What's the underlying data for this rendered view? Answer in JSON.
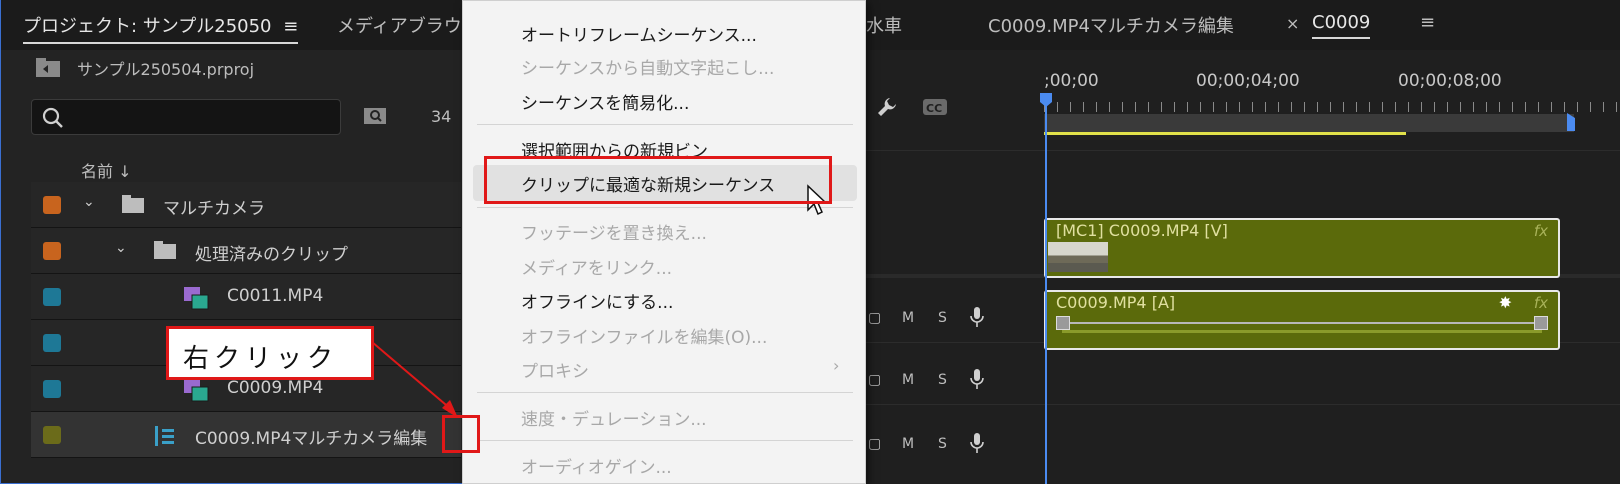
{
  "project_panel": {
    "tab_project": "プロジェクト: サンプル25050",
    "tab_project_menu": "≡",
    "tab_media_browser": "メディアブラウ",
    "project_file": "サンプル250504.prproj",
    "search_value": "",
    "item_count": "34",
    "column_name": "名前 ↓",
    "rows": [
      {
        "label": "マルチカメラ",
        "swatch": "#c8641e",
        "chevron": "⌄",
        "icon": "folder-icon"
      },
      {
        "label": "処理済みのクリップ",
        "swatch": "#c8641e",
        "chevron": "⌄",
        "icon": "folder-icon"
      },
      {
        "label": "C0011.MP4",
        "swatch": "#1e7896",
        "icon": "video-clip-icon"
      },
      {
        "label": "",
        "swatch": "#1e7896",
        "icon": ""
      },
      {
        "label": "C0009.MP4",
        "swatch": "#1e7896",
        "icon": "video-clip-icon"
      },
      {
        "label": "C0009.MP4マルチカメラ編集",
        "swatch": "#6b6b1a",
        "icon": "multicam-sequence-icon"
      }
    ]
  },
  "timeline_panel": {
    "tabs": [
      {
        "label": "水車"
      },
      {
        "label": "C0009.MP4マルチカメラ編集"
      }
    ],
    "tab_close": "×",
    "active_tab": "C0009",
    "active_tab_menu": "≡",
    "timecodes": [
      ";00;00",
      "00;00;04;00",
      "00;00;08;00"
    ],
    "video_clip_label": "[MC1] C0009.MP4 [V]",
    "audio_clip_label": "C0009.MP4 [A]",
    "fx_label": "fx",
    "track_mute": "M",
    "track_solo": "S"
  },
  "context_menu": {
    "items": [
      {
        "label": "オートリフレームシーケンス...",
        "enabled": true
      },
      {
        "label": "シーケンスから自動文字起こし...",
        "enabled": false
      },
      {
        "label": "シーケンスを簡易化...",
        "enabled": true
      },
      {
        "label": "選択範囲からの新規ビン",
        "enabled": true
      },
      {
        "label": "クリップに最適な新規シーケンス",
        "enabled": true,
        "highlighted": true
      },
      {
        "label": "フッテージを置き換え...",
        "enabled": false
      },
      {
        "label": "メディアをリンク...",
        "enabled": false
      },
      {
        "label": "オフラインにする...",
        "enabled": true
      },
      {
        "label": "オフラインファイルを編集(O)...",
        "enabled": false
      },
      {
        "label": "プロキシ",
        "enabled": false,
        "submenu": true
      },
      {
        "label": "速度・デュレーション...",
        "enabled": false
      },
      {
        "label": "オーディオゲイン...",
        "enabled": false
      }
    ],
    "submenu_arrow": "›"
  },
  "annotation": {
    "callout_text": "右クリック",
    "highlight_color": "#e01818"
  }
}
